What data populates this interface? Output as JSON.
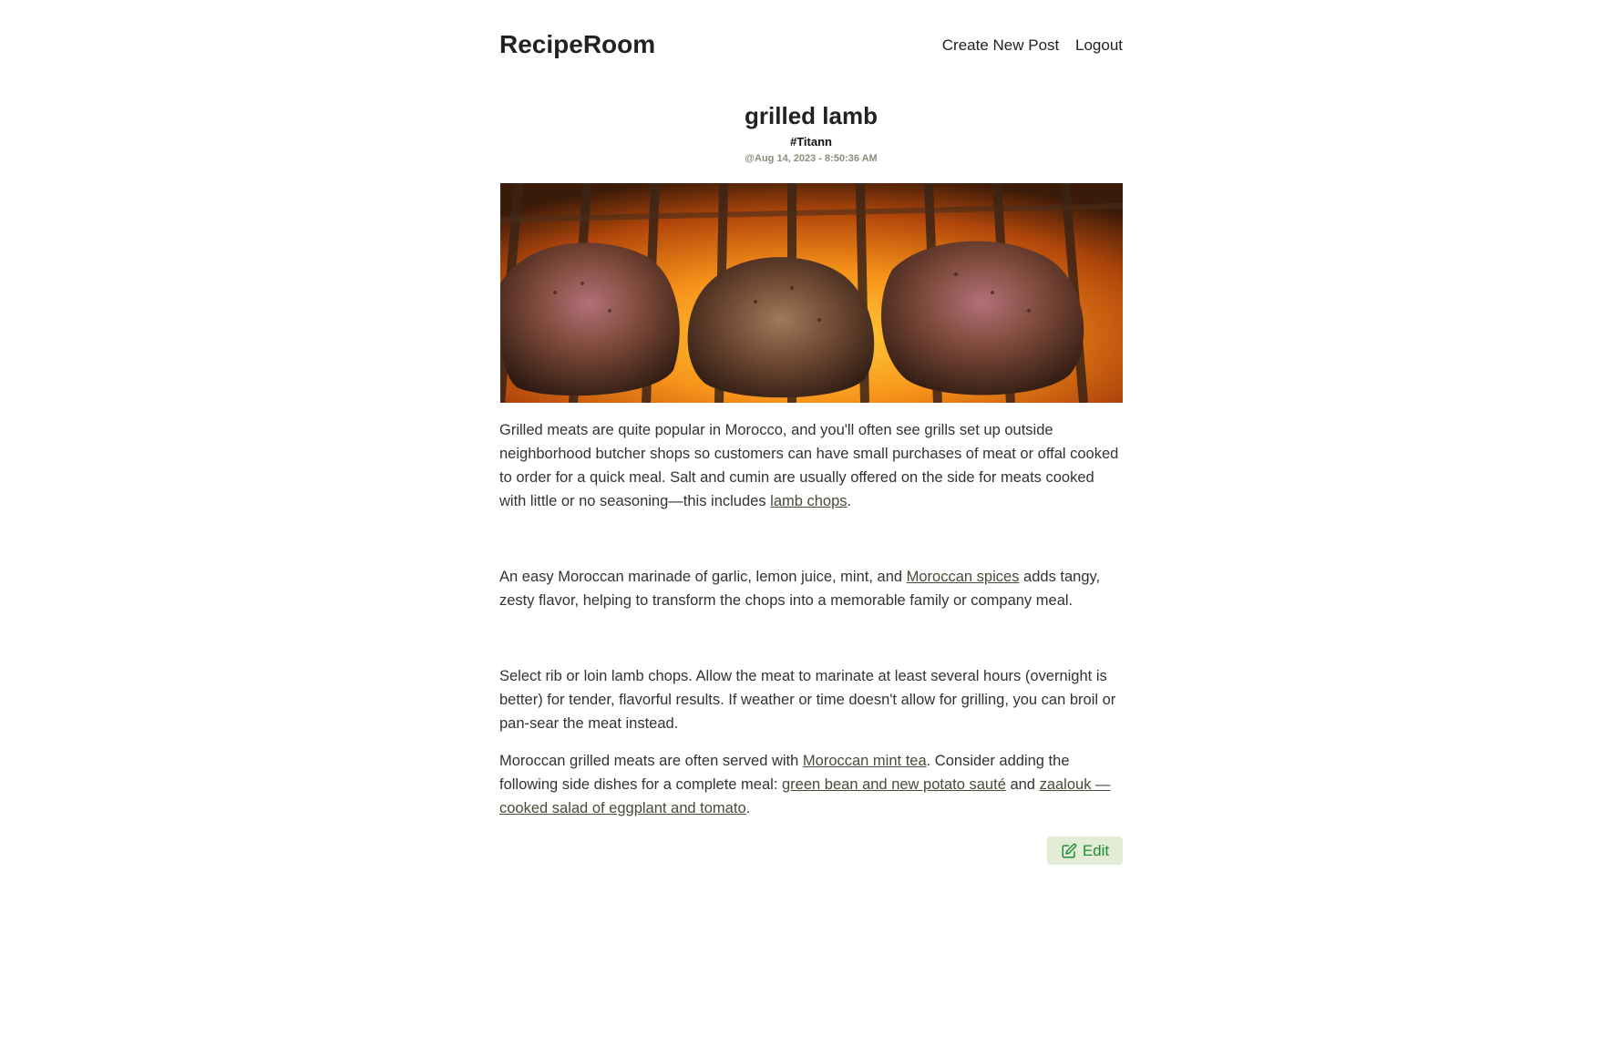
{
  "header": {
    "brand": "RecipeRoom",
    "nav": {
      "create_label": "Create New Post",
      "logout_label": "Logout"
    }
  },
  "post": {
    "title": "grilled lamb",
    "author": "#Titann",
    "date": "@Aug 14, 2023 - 8:50:36 AM",
    "image_alt": "grilled lamb chops over flames",
    "paragraphs": {
      "p1": {
        "text": "Grilled meats are quite popular in Morocco, and you'll often see grills set up outside neighborhood butcher shops so customers can have small purchases of meat or offal cooked to order for a quick meal. Salt and cumin are usually offered on the side for meats cooked with little or no seasoning—this includes ",
        "link": "lamb chops",
        "end": "."
      },
      "p2": {
        "text": "An easy Moroccan marinade of garlic, lemon juice, mint, and ",
        "link": "Moroccan spices",
        "end": " adds tangy, zesty flavor, helping to transform the chops into a memorable family or company meal."
      },
      "p3": {
        "text": "Select rib or loin lamb chops. Allow the meat to marinate at least several hours (overnight is better) for tender, flavorful results. If weather or time doesn't allow for grilling, you can broil or pan-sear the meat instead."
      },
      "p4": {
        "text": "Moroccan grilled meats are often served with ",
        "link1": "Moroccan mint tea",
        "mid": ". Consider adding the following side dishes for a complete meal: ",
        "link2": "green bean and new potato sauté",
        "and": " and ",
        "link3": "zaalouk —cooked salad of eggplant and tomato",
        "end": "."
      }
    },
    "edit_label": "Edit"
  },
  "colors": {
    "edit_bg": "#e3ecd4",
    "edit_text": "#1e8f3a",
    "date_text": "#8a8f7a"
  },
  "icons": {
    "edit": "pencil-square-icon"
  }
}
